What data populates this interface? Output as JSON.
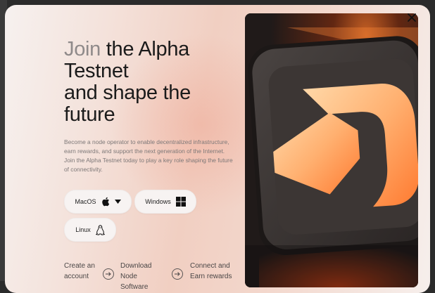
{
  "modal": {
    "title_highlight": "Join",
    "title_line1_rest": " the Alpha",
    "title_line2": "Testnet",
    "title_line3": "and shape the",
    "title_line4": "future",
    "description": "Become a node operator to enable decentralized infrastructure, earn rewards, and support the next generation of the Internet. Join the Alpha Testnet today to play a key role shaping the future of connectivity.",
    "os_buttons": [
      {
        "label": "MacOS",
        "icon": "apple-icon"
      },
      {
        "label": "Windows",
        "icon": "windows-icon"
      },
      {
        "label": "Linux",
        "icon": "linux-icon"
      }
    ],
    "steps": [
      {
        "label": "Create an account"
      },
      {
        "label": "Download Node Software"
      },
      {
        "label": "Connect and Earn rewards"
      }
    ],
    "close_icon": "close-icon",
    "hero_image": "glowing-logo-icon"
  },
  "colors": {
    "title": "#1b1b1b",
    "title_muted": "#8f8a8a",
    "glow_orange": "#ff8a3a"
  }
}
